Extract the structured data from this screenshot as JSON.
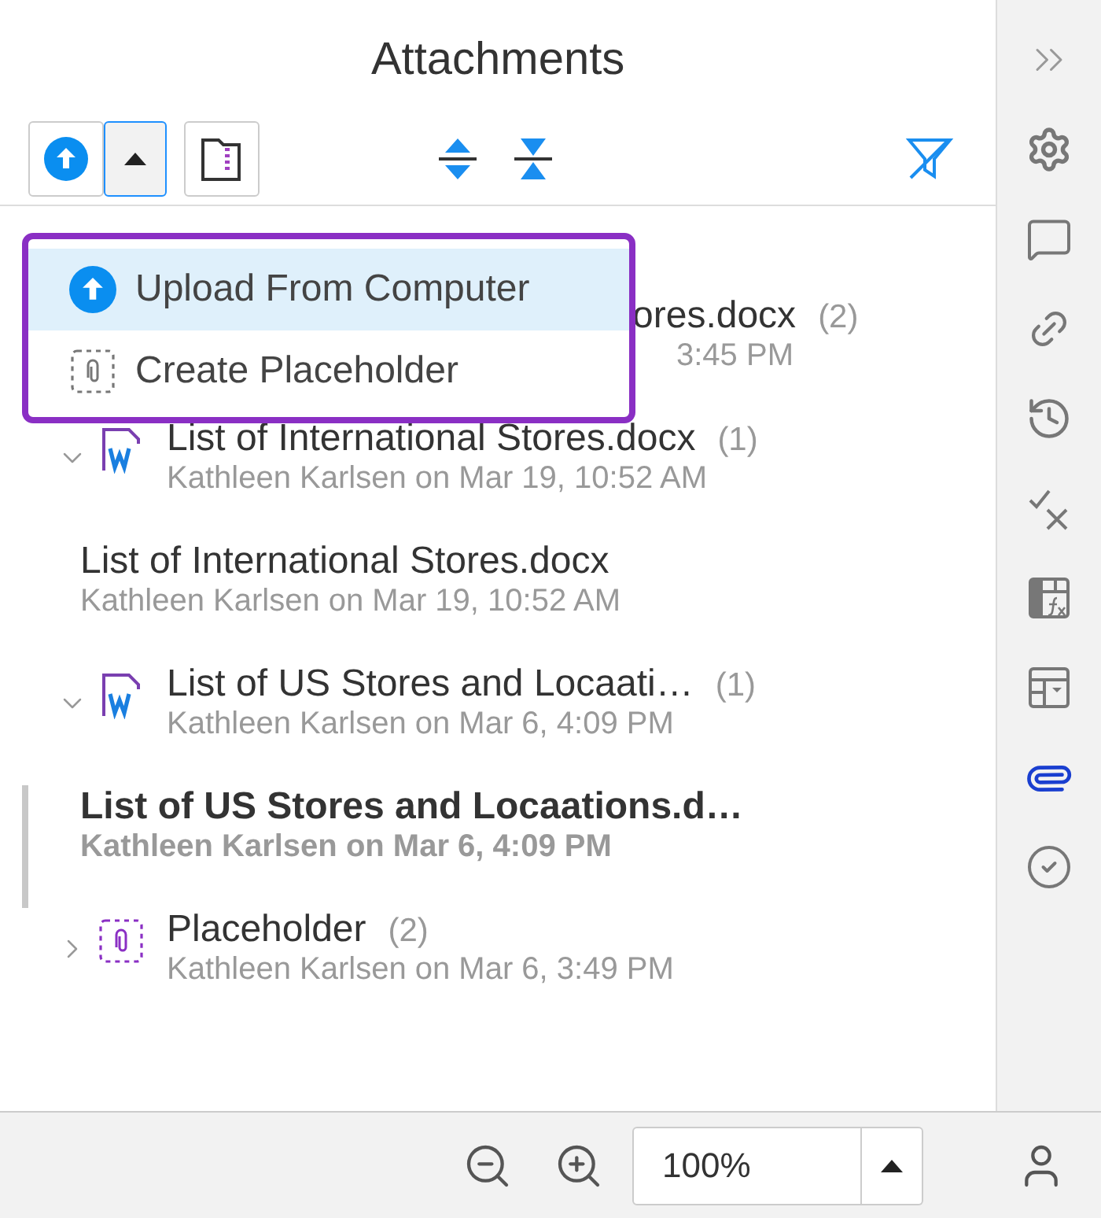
{
  "title": "Attachments",
  "toolbar": {
    "menu_open": true
  },
  "menu": [
    {
      "kind": "upload",
      "label": "Upload From Computer",
      "selected": true
    },
    {
      "kind": "placeholder",
      "label": "Create Placeholder",
      "selected": false
    }
  ],
  "items": [
    {
      "kind": "covered",
      "title": "ores.docx",
      "count": "(2)",
      "meta": "3:45 PM"
    },
    {
      "kind": "word",
      "title": "List of International Stores.docx",
      "count": "(1)",
      "meta": "Kathleen Karlsen on Mar 19, 10:52 AM",
      "expanded": true,
      "children": [
        {
          "title": "List of International Stores.docx",
          "meta": "Kathleen Karlsen on Mar 19, 10:52 AM",
          "selected": false
        }
      ]
    },
    {
      "kind": "word",
      "title": "List of US Stores and Locaati…",
      "count": "(1)",
      "meta": "Kathleen Karlsen on Mar 6, 4:09 PM",
      "expanded": true,
      "children": [
        {
          "title": "List of US Stores and Locaations.d…",
          "meta": "Kathleen Karlsen on Mar 6, 4:09 PM",
          "selected": true
        }
      ]
    },
    {
      "kind": "placeholder",
      "title": "Placeholder",
      "count": "(2)",
      "meta": "Kathleen Karlsen on Mar 6, 3:49 PM",
      "expanded": false
    }
  ],
  "zoom": {
    "value": "100%"
  }
}
